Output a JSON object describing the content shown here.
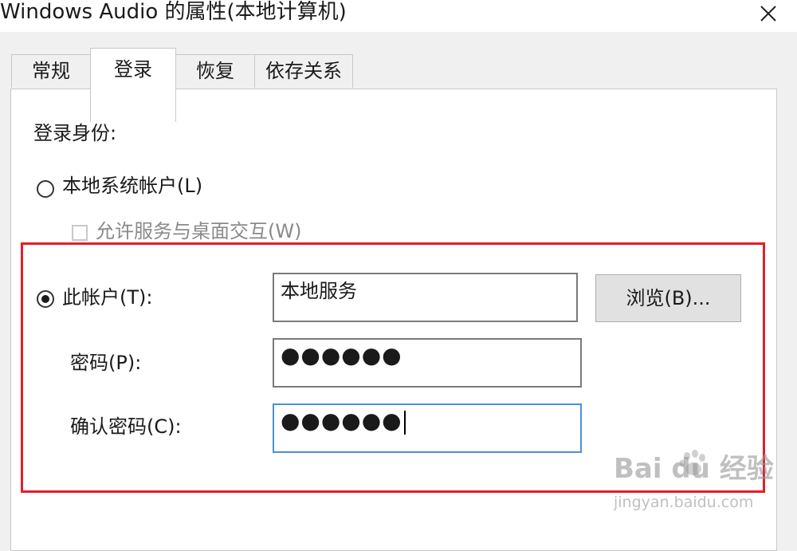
{
  "window": {
    "title": "Windows Audio 的属性(本地计算机)"
  },
  "tabs": [
    {
      "label": "常规"
    },
    {
      "label": "登录"
    },
    {
      "label": "恢复"
    },
    {
      "label": "依存关系"
    }
  ],
  "active_tab": "登录",
  "logon": {
    "section_label": "登录身份:",
    "local_system": {
      "label": "本地系统帐户(L)",
      "selected": false
    },
    "interact_desktop": {
      "label": "允许服务与桌面交互(W)",
      "checked": false,
      "enabled": false
    },
    "this_account": {
      "label": "此帐户(T):",
      "selected": true,
      "value": "本地服务"
    },
    "browse_button": "浏览(B)...",
    "password": {
      "label": "密码(P):",
      "value": "●●●●●●"
    },
    "confirm_password": {
      "label": "确认密码(C):",
      "value": "●●●●●●"
    }
  },
  "watermark": {
    "logo": "Bai du 经验",
    "url": "jingyan.baidu.com"
  },
  "colors": {
    "highlight_box": "#e0202a",
    "focus_border": "#4a90d9"
  }
}
